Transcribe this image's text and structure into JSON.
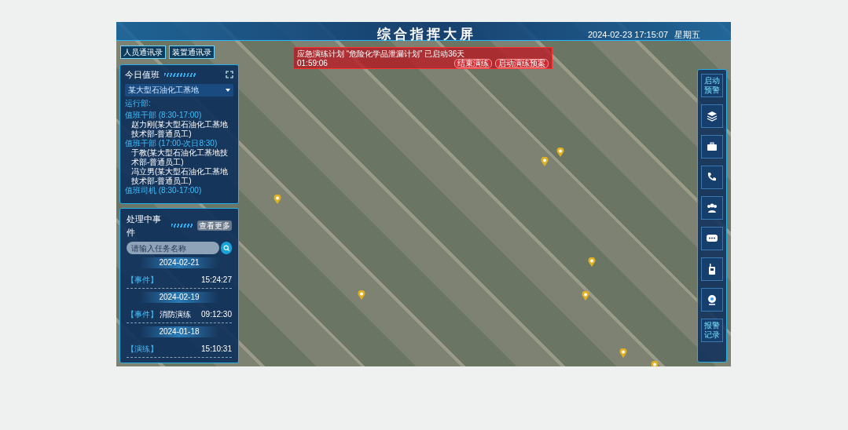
{
  "header": {
    "title": "综合指挥大屏",
    "date_time": "2024-02-23 17:15:07",
    "weekday": "星期五"
  },
  "directory_tabs": [
    {
      "label": "人员通讯录"
    },
    {
      "label": "装置通讯录"
    }
  ],
  "alert_banner": {
    "message": "应急演练计划 “危险化学品泄漏计划” 已启动36天",
    "timer": "01:59:06",
    "buttons": [
      "结束演练",
      "启动演练预案"
    ]
  },
  "duty_panel": {
    "title": "今日值班",
    "site_select": {
      "value": "某大型石油化工基地"
    },
    "department": "运行部:",
    "shifts": [
      {
        "label": "值班干部 (8:30-17:00)",
        "children": [
          {
            "label": "赵力刚(某大型石油化工基地技术部-普通员工)"
          }
        ]
      },
      {
        "label": "值班干部 (17:00-次日8:30)",
        "children": [
          {
            "label": "于教(某大型石油化工基地技术部-普通员工)"
          },
          {
            "label": "冯立男(某大型石油化工基地技术部-普通员工)"
          }
        ]
      },
      {
        "label": "值班司机 (8:30-17:00)"
      }
    ]
  },
  "events_panel": {
    "title": "处理中事件",
    "more_button": "查看更多",
    "search": {
      "placeholder": "请输入任务名称"
    },
    "groups": [
      {
        "date": "2024-02-21",
        "items": [
          {
            "tag": "【事件】",
            "time": "15:24:27"
          }
        ]
      },
      {
        "date": "2024-02-19",
        "items": [
          {
            "tag": "【事件】",
            "name": "消防演练",
            "time": "09:12:30"
          }
        ]
      },
      {
        "date": "2024-01-18",
        "items": [
          {
            "tag": "【演练】",
            "time": "15:10:31"
          }
        ]
      }
    ]
  },
  "right_toolbar": {
    "top_button": "启动预警",
    "bottom_button": "报警记录"
  }
}
